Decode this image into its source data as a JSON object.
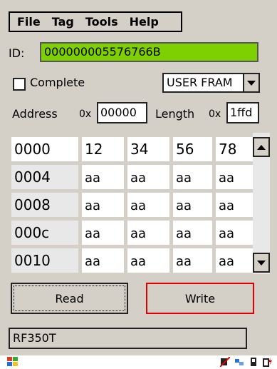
{
  "menu": {
    "items": [
      "File",
      "Tag",
      "Tools",
      "Help"
    ]
  },
  "id_field": {
    "label": "ID:",
    "value": "000000005576766B"
  },
  "complete": {
    "label": "Complete",
    "checked": false
  },
  "memory_select": {
    "value": "USER FRAM"
  },
  "address": {
    "label": "Address",
    "prefix": "0x",
    "value": "00000"
  },
  "length": {
    "label": "Length",
    "prefix": "0x",
    "value": "1ffd"
  },
  "grid": {
    "rows": [
      {
        "addr": "0000",
        "bytes": [
          "12",
          "34",
          "56",
          "78"
        ]
      },
      {
        "addr": "0004",
        "bytes": [
          "aa",
          "aa",
          "aa",
          "aa"
        ]
      },
      {
        "addr": "0008",
        "bytes": [
          "aa",
          "aa",
          "aa",
          "aa"
        ]
      },
      {
        "addr": "000c",
        "bytes": [
          "aa",
          "aa",
          "aa",
          "aa"
        ]
      },
      {
        "addr": "0010",
        "bytes": [
          "aa",
          "aa",
          "aa",
          "aa"
        ]
      }
    ]
  },
  "buttons": {
    "read": "Read",
    "write": "Write"
  },
  "status": {
    "text": "RF350T"
  },
  "colors": {
    "id_background": "#7fd000",
    "write_border": "#e00000"
  }
}
